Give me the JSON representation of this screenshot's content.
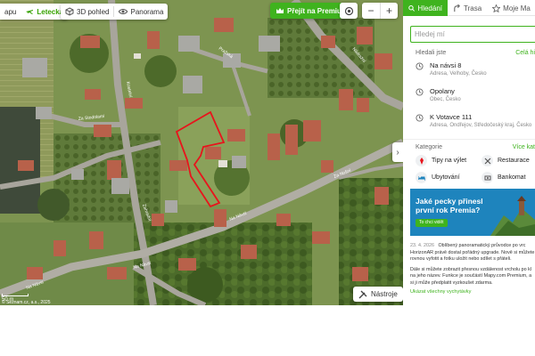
{
  "map": {
    "toolbar": {
      "map_type_label": "apu",
      "aerial_label": "Letecká",
      "threed_label": "3D pohled",
      "panorama_label": "Panorama"
    },
    "premium_button_label": "Přejít na Premium",
    "zoom_in_label": "+",
    "zoom_out_label": "−",
    "collapse_label": "›",
    "tools_label": "Nástroje",
    "scale_label": "50 m",
    "copyright": "© Seznam.cz, a.s., 2025",
    "street_labels": [
      "Za Stodolami",
      "Na Návsi",
      "Na Návsi",
      "Na Návsi",
      "Kostelní",
      "Za Nošní",
      "Nádražní",
      "Pražská",
      "Zahradní"
    ],
    "colors": {
      "parcel_outline": "#e8141c",
      "brand_green": "#3fb31e"
    }
  },
  "panel": {
    "tabs": [
      {
        "label": "Hledání",
        "icon": "search-icon",
        "active": true
      },
      {
        "label": "Trasa",
        "icon": "route-icon",
        "active": false
      },
      {
        "label": "Moje Ma",
        "icon": "star-icon",
        "active": false
      }
    ],
    "search": {
      "placeholder": "Hledej mí",
      "value": ""
    },
    "recent": {
      "title": "Hledali jste",
      "all_label": "Celá hi",
      "items": [
        {
          "name": "Na návsi 8",
          "desc": "Adresa, Velhoby, Česko"
        },
        {
          "name": "Opolany",
          "desc": "Obec, Česko"
        },
        {
          "name": "K Votavce 111",
          "desc": "Adresa, Ondřejov, Středočeský kraj, Česko"
        }
      ]
    },
    "categories": {
      "title": "Kategorie",
      "more_label": "Více kat",
      "items": [
        {
          "label": "Tipy na výlet",
          "icon": "trip-icon",
          "color": "#e8141c"
        },
        {
          "label": "Restaurace",
          "icon": "restaurant-icon",
          "color": "#555555"
        },
        {
          "label": "Ubytování",
          "icon": "bed-icon",
          "color": "#1e84bd"
        },
        {
          "label": "Bankomat",
          "icon": "atm-icon",
          "color": "#555555"
        }
      ]
    },
    "banner": {
      "title": "Jaké pecky přinesl první rok Premia?",
      "button_label": "To chci vidět"
    },
    "news": {
      "date": "23. 4. 2026",
      "lines": [
        "Oblíbený panoramatický průvodce po vrc",
        "HorizonAR právě dostal pořádný upgrade. Nově si můžete",
        "rovnou vyfotit a fotku uložit nebo sdílet s přáteli.",
        "Dále si můžete zobrazit přesnou vzdálenost vrcholu po kl",
        "na jeho název. Funkce je součástí Mapy.com Premium, a",
        "si ji může předplatit vyzkoušet zdarma."
      ],
      "more_label": "Ukázat všechny vychytávky"
    }
  }
}
